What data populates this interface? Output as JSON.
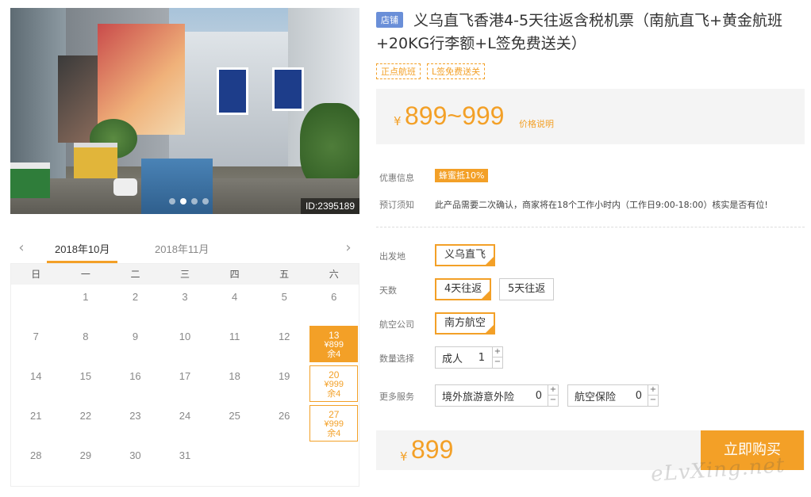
{
  "photo": {
    "id_label": "ID:2395189"
  },
  "calendar": {
    "prev_icon": "chevron-left-icon",
    "next_icon": "chevron-right-icon",
    "tabs": [
      "2018年10月",
      "2018年11月"
    ],
    "weekdays": [
      "日",
      "一",
      "二",
      "三",
      "四",
      "五",
      "六"
    ],
    "rows": [
      [
        {
          "d": ""
        },
        {
          "d": "1"
        },
        {
          "d": "2"
        },
        {
          "d": "3"
        },
        {
          "d": "4"
        },
        {
          "d": "5"
        },
        {
          "d": "6"
        }
      ],
      [
        {
          "d": "7"
        },
        {
          "d": "8"
        },
        {
          "d": "9"
        },
        {
          "d": "10"
        },
        {
          "d": "11"
        },
        {
          "d": "12"
        },
        {
          "d": "13",
          "price": "¥899",
          "left": "余4",
          "selected": true
        }
      ],
      [
        {
          "d": "14"
        },
        {
          "d": "15"
        },
        {
          "d": "16"
        },
        {
          "d": "17"
        },
        {
          "d": "18"
        },
        {
          "d": "19"
        },
        {
          "d": "20",
          "price": "¥999",
          "left": "余4"
        }
      ],
      [
        {
          "d": "21"
        },
        {
          "d": "22"
        },
        {
          "d": "23"
        },
        {
          "d": "24"
        },
        {
          "d": "25"
        },
        {
          "d": "26"
        },
        {
          "d": "27",
          "price": "¥999",
          "left": "余4"
        }
      ],
      [
        {
          "d": "28"
        },
        {
          "d": "29"
        },
        {
          "d": "30"
        },
        {
          "d": "31"
        },
        {
          "d": ""
        },
        {
          "d": ""
        },
        {
          "d": ""
        }
      ]
    ]
  },
  "product": {
    "badge": "店铺",
    "title": "义乌直飞香港4-5天往返含税机票（南航直飞+黄金航班+20KG行李额+L签免费送关）",
    "tags": [
      "正点航班",
      "L签免费送关"
    ],
    "price_symbol": "¥",
    "price_range": "899~999",
    "price_explain": "价格说明"
  },
  "info": {
    "discount_label": "优惠信息",
    "discount_value": "蜂蜜抵10%",
    "notice_label": "预订须知",
    "notice_value": "此产品需要二次确认，商家将在18个工作小时内（工作日9:00-18:00）核实是否有位!"
  },
  "options": {
    "departure_label": "出发地",
    "departure": "义乌直飞",
    "days_label": "天数",
    "days": [
      "4天往返",
      "5天往返"
    ],
    "airline_label": "航空公司",
    "airline": "南方航空",
    "qty_label": "数量选择",
    "qty_name": "成人",
    "qty_value": "1",
    "services_label": "更多服务",
    "service1_name": "境外旅游意外险",
    "service1_value": "0",
    "service2_name": "航空保险",
    "service2_value": "0",
    "plus": "+",
    "minus": "−"
  },
  "total": {
    "symbol": "¥",
    "amount": "899"
  },
  "buy_label": "立即购买",
  "watermark": "eLvXing.net",
  "colors": {
    "accent": "#f3a027",
    "badge": "#6a8fd8"
  }
}
